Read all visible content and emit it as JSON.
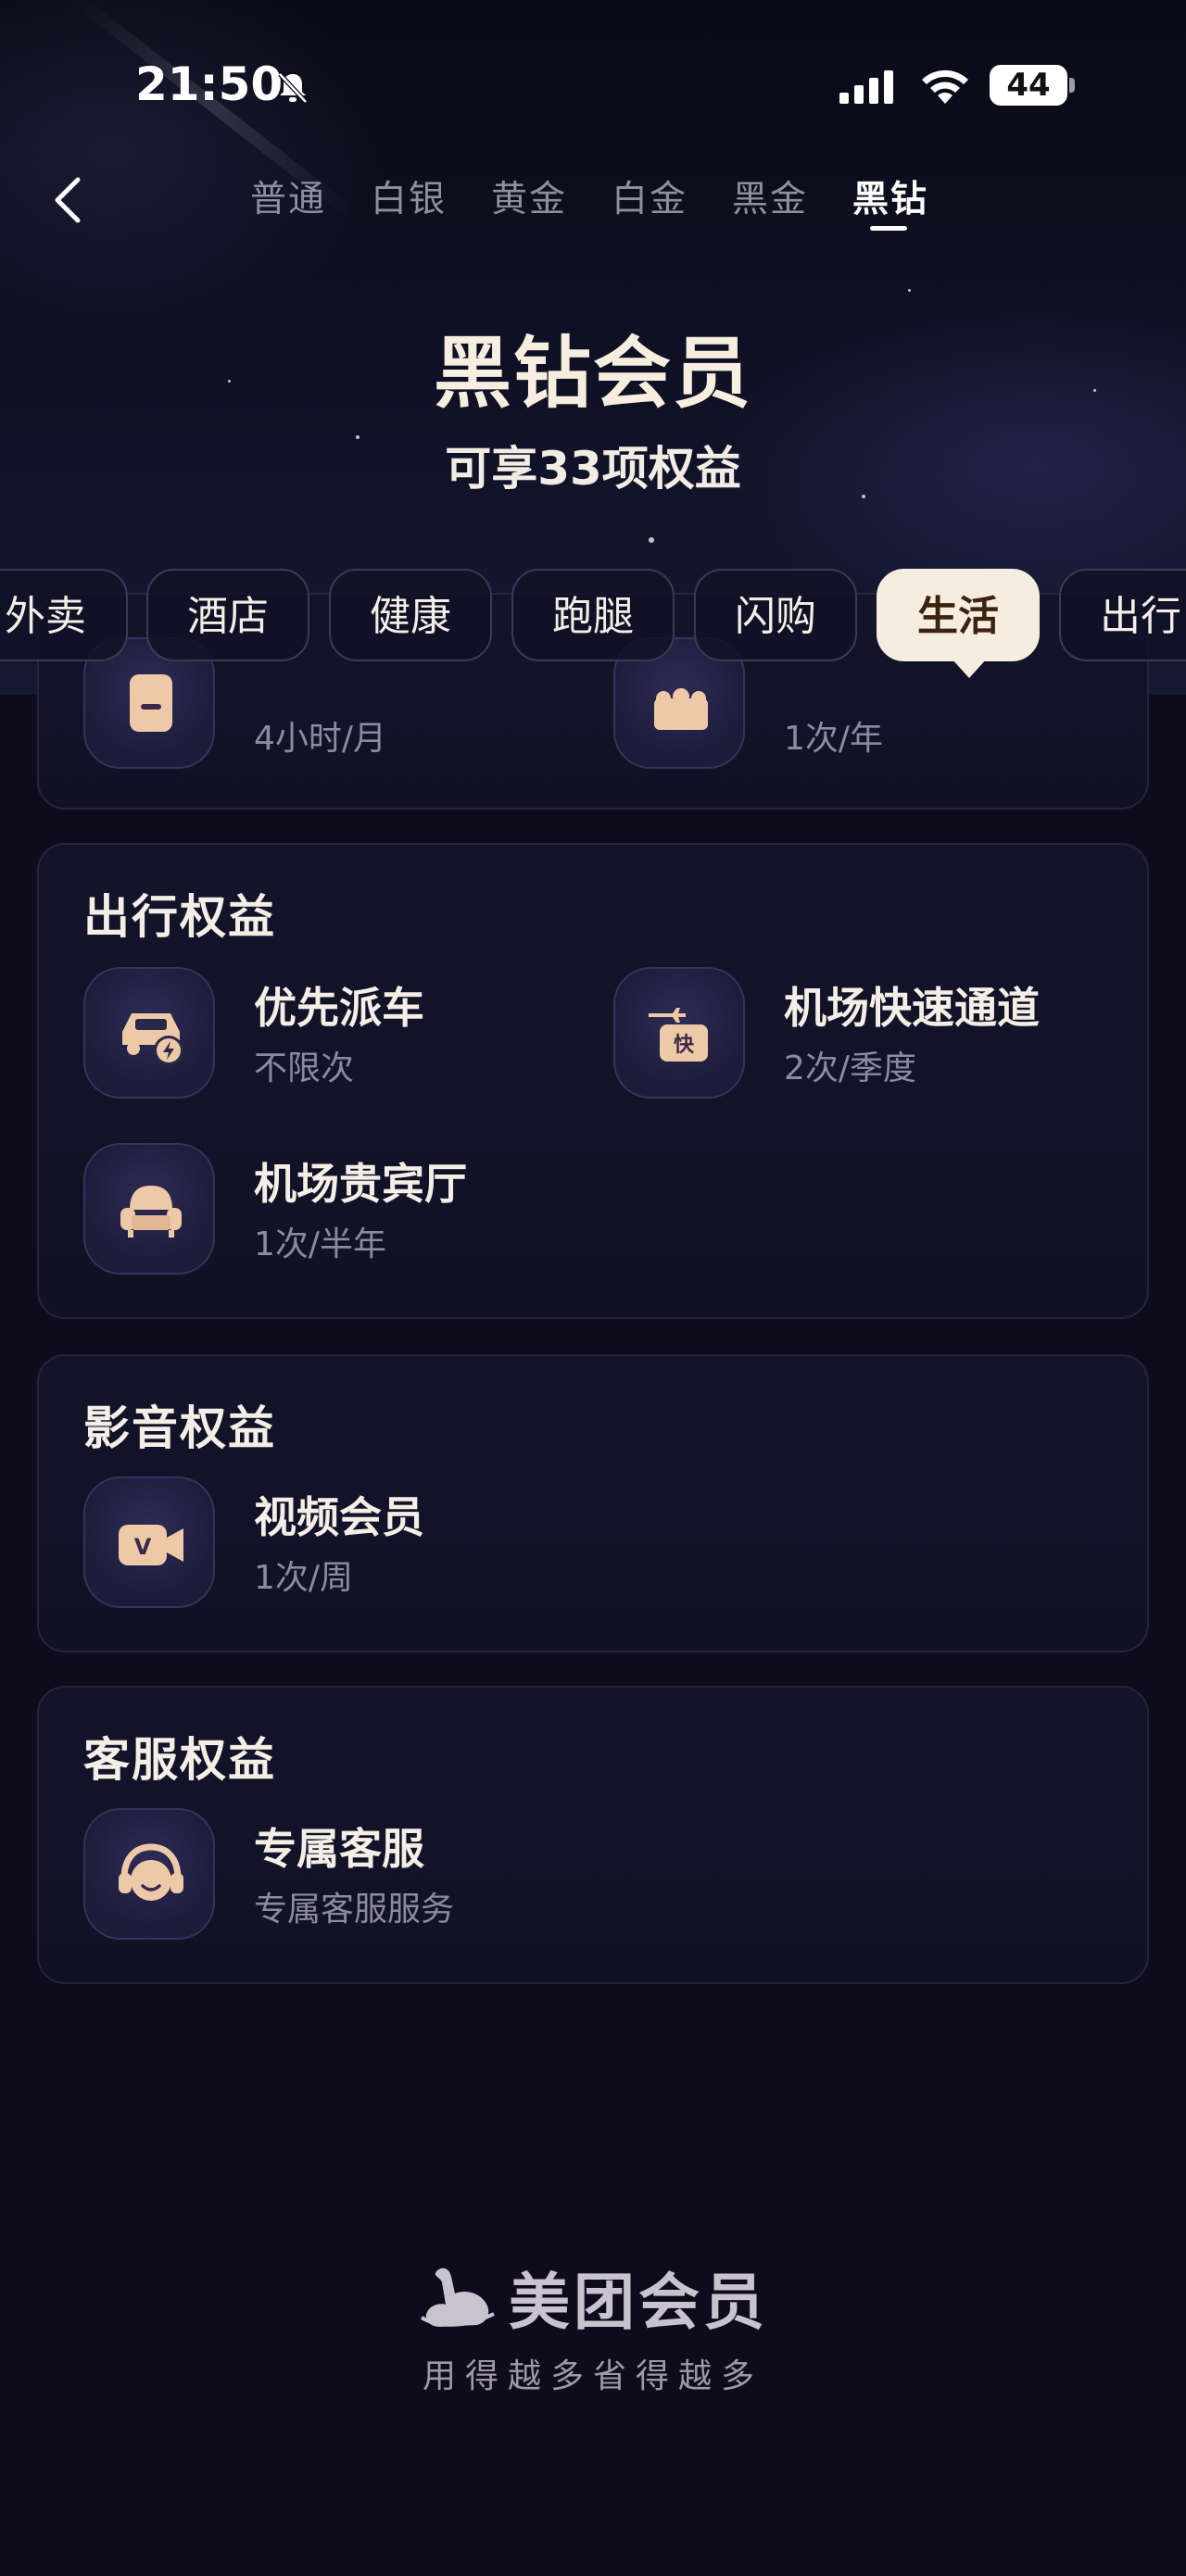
{
  "status_bar": {
    "time": "21:50",
    "battery": "44",
    "icons": [
      "bell-off-icon",
      "signal-icon",
      "wifi-icon",
      "battery-icon"
    ]
  },
  "nav": {
    "back_icon": "chevron-left-icon",
    "tiers": [
      {
        "label": "普通",
        "active": false
      },
      {
        "label": "白银",
        "active": false
      },
      {
        "label": "黄金",
        "active": false
      },
      {
        "label": "白金",
        "active": false
      },
      {
        "label": "黑金",
        "active": false
      },
      {
        "label": "黑钻",
        "active": true
      }
    ]
  },
  "header": {
    "title": "黑钻会员",
    "subtitle": "可享33项权益"
  },
  "categories": [
    {
      "label": "外卖",
      "active": false
    },
    {
      "label": "酒店",
      "active": false
    },
    {
      "label": "健康",
      "active": false
    },
    {
      "label": "跑腿",
      "active": false
    },
    {
      "label": "闪购",
      "active": false
    },
    {
      "label": "生活",
      "active": true
    },
    {
      "label": "出行",
      "active": false
    }
  ],
  "partial_card": {
    "items": [
      {
        "icon": "document-icon",
        "desc": "4小时/月"
      },
      {
        "icon": "cake-icon",
        "desc": "1次/年"
      }
    ]
  },
  "sections": [
    {
      "title": "出行权益",
      "items": [
        {
          "name": "优先派车",
          "desc": "不限次",
          "icon": "car-icon"
        },
        {
          "name": "机场快速通道",
          "desc": "2次/季度",
          "icon": "airport-fast-track-icon",
          "badge": "快"
        },
        {
          "name": "机场贵宾厅",
          "desc": "1次/半年",
          "icon": "armchair-icon"
        }
      ]
    },
    {
      "title": "影音权益",
      "items": [
        {
          "name": "视频会员",
          "desc": "1次/周",
          "icon": "video-camera-icon",
          "badge": "V"
        }
      ]
    },
    {
      "title": "客服权益",
      "items": [
        {
          "name": "专属客服",
          "desc": "专属客服服务",
          "icon": "headset-icon"
        }
      ]
    }
  ],
  "footer": {
    "brand": "美团会员",
    "slogan": "用得越多省得越多",
    "logo_icon": "meituan-kangaroo-logo"
  },
  "colors": {
    "background": "#0d0b1c",
    "card": "#13132a",
    "chip_active": "#f6ede1",
    "accent_text": "#f8eedf",
    "muted_text": "#8d8aa0"
  }
}
